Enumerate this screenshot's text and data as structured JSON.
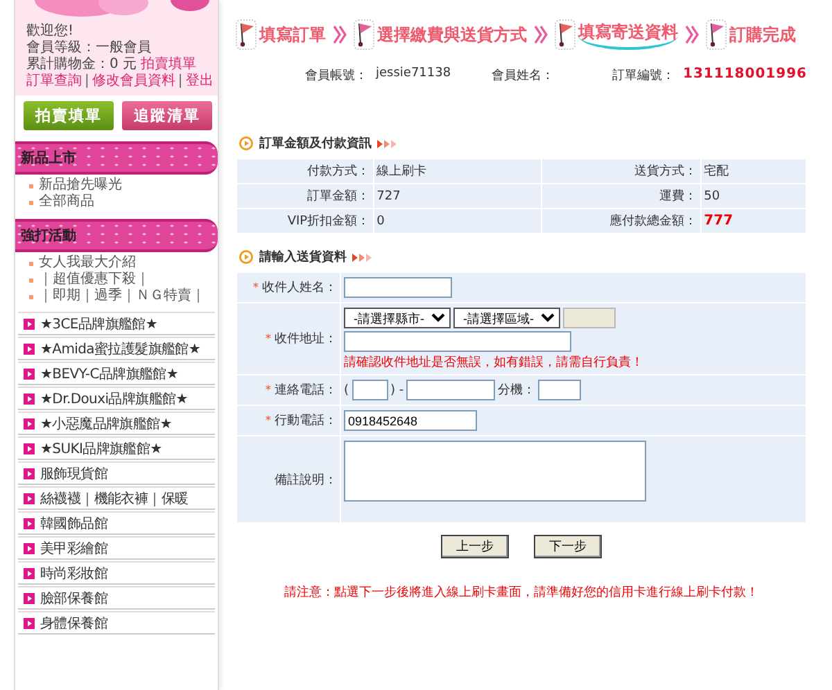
{
  "member_box": {
    "greeting": "歡迎您!",
    "level": "會員等級：一般會員",
    "spent": "累計購物金：0 元",
    "spent_link": "拍賣填單",
    "links": [
      "訂單查詢",
      "修改會員資料",
      "登出"
    ],
    "link_separator": "|"
  },
  "side_buttons": [
    {
      "label": "拍賣填單",
      "kind": "green"
    },
    {
      "label": "追蹤清單",
      "kind": "pink"
    }
  ],
  "side_sections": [
    {
      "title": "新品上市",
      "links": [
        "新品搶先曝光",
        "全部商品"
      ]
    },
    {
      "title": "強打活動",
      "links": [
        "女人我最大介紹",
        "｜超值優惠下殺｜",
        "｜即期｜過季｜ＮＧ特賣｜"
      ]
    }
  ],
  "shop_links": [
    "★3CE品牌旗艦館★",
    "★Amida蜜拉護髮旗艦館★",
    "★BEVY-C品牌旗艦館★",
    "★Dr.Douxi品牌旗艦館★",
    "★小惡魔品牌旗艦館★",
    "★SUKI品牌旗艦館★",
    "服飾現貨館",
    "絲襪襪｜機能衣褲｜保暖",
    "韓國飾品館",
    "美甲彩繪館",
    "時尚彩妝館",
    "臉部保養館",
    "身體保養館"
  ],
  "steps": [
    {
      "label": "填寫訂單",
      "current": false,
      "color": "#e8605a"
    },
    {
      "label": "選擇繳費與送貨方式",
      "current": false,
      "color": "#e0609c"
    },
    {
      "label": "填寫寄送資料",
      "current": true,
      "color": "#e8605a"
    },
    {
      "label": "訂購完成",
      "current": false,
      "color": "#e0609c"
    }
  ],
  "member_info": {
    "account_label": "會員帳號：",
    "account": "jessie71138",
    "name_label": "會員姓名：",
    "order_label": "訂單編號：",
    "order_no": "131118001996"
  },
  "order_summary": {
    "title": "訂單金額及付款資訊",
    "rows": [
      [
        {
          "label": "付款方式：",
          "value": "線上刷卡",
          "highlight": false
        },
        {
          "label": "送貨方式：",
          "value": "宅配",
          "highlight": false
        }
      ],
      [
        {
          "label": "訂單金額：",
          "value": "727",
          "highlight": false
        },
        {
          "label": "運費：",
          "value": "50",
          "highlight": false
        }
      ],
      [
        {
          "label": "VIP折扣金額：",
          "value": "0",
          "highlight": false
        },
        {
          "label": "應付款總金額：",
          "value": "777",
          "highlight": true
        }
      ]
    ]
  },
  "shipping_form": {
    "title": "請輸入送貨資料",
    "fields": [
      {
        "kind": "text",
        "required_mark": "＊",
        "label": "收件人姓名："
      },
      {
        "kind": "address",
        "required_mark": "＊",
        "label": "收件地址：",
        "city_select": "-請選擇縣市-",
        "district_select": "-請選擇區域-",
        "zip_disabled": true,
        "warning": "請確認收件地址是否無誤，如有錯誤，請需自行負責！"
      },
      {
        "kind": "phone",
        "required_mark": "＊",
        "label": "連絡電話：",
        "open": "(",
        "close": ") -",
        "ext_label": "分機："
      },
      {
        "kind": "text",
        "required_mark": "＊",
        "label": "行動電話：",
        "value": "0918452648"
      },
      {
        "kind": "textarea",
        "label": "備註說明："
      }
    ]
  },
  "actions": [
    "上一步",
    "下一步"
  ],
  "notice": "請注意：點選下一步後將進入線上刷卡畫面，請準備好您的信用卡進行線上刷卡付款！"
}
